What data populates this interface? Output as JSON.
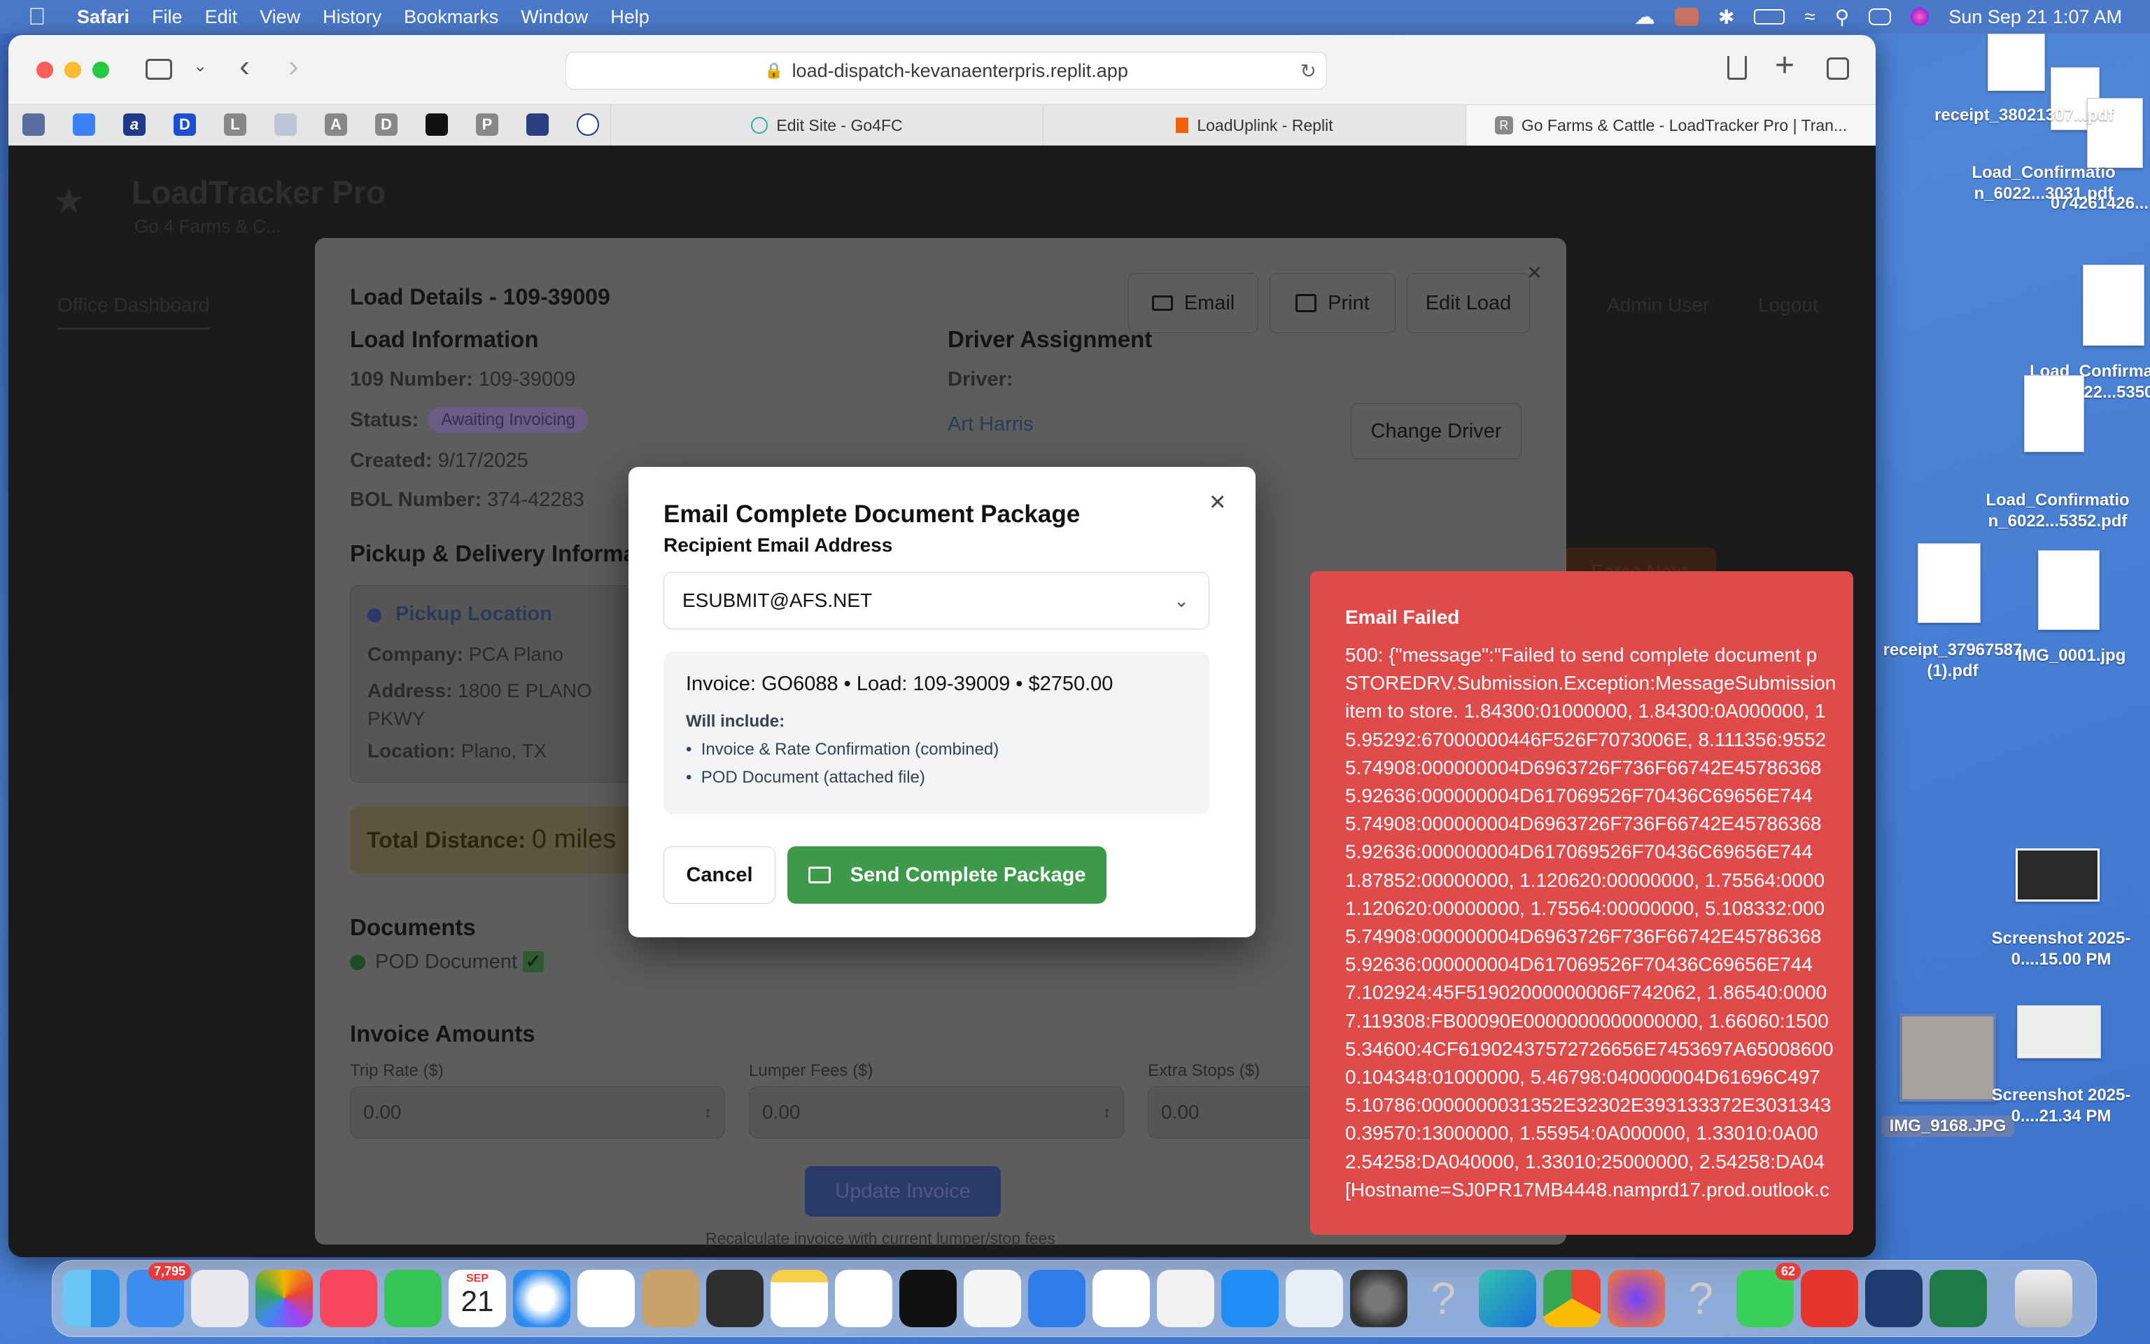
{
  "menubar": {
    "apple": "",
    "app": "Safari",
    "items": [
      "File",
      "Edit",
      "View",
      "History",
      "Bookmarks",
      "Window",
      "Help"
    ],
    "clock": "Sun Sep 21  1:07 AM"
  },
  "browser": {
    "url": "load-dispatch-kevanaenterpris.replit.app",
    "favorites": [
      "",
      "",
      "a",
      "D",
      "L",
      "",
      "A",
      "D",
      "",
      "P",
      "",
      ""
    ],
    "tabs": [
      {
        "label": "Edit Site - Go4FC",
        "active": false
      },
      {
        "label": "LoadUplink - Replit",
        "active": false
      },
      {
        "label": "Go Farms & Cattle - LoadTracker Pro | Tran...",
        "active": true
      }
    ]
  },
  "background_app": {
    "title": "LoadTracker Pro",
    "subtitle": "Go 4 Farms & C...",
    "tab_office": "Office Dashboard",
    "admin_user": "Admin User",
    "logout": "Logout",
    "force_next": "Force Next",
    "bottom_note": "..."
  },
  "load_modal": {
    "title": "Load Details - 109-39009",
    "email_btn": "Email",
    "print_btn": "Print",
    "edit_btn": "Edit Load",
    "load_info_heading": "Load Information",
    "number_label": "109 Number:",
    "number_value": "109-39009",
    "status_label": "Status:",
    "status_value": "Awaiting Invoicing",
    "created_label": "Created:",
    "created_value": "9/17/2025",
    "bol_label": "BOL Number:",
    "bol_value": "374-42283",
    "driver_heading": "Driver Assignment",
    "driver_label": "Driver:",
    "driver_name": "Art Harris",
    "change_driver": "Change Driver",
    "pickup_heading": "Pickup & Delivery Informa",
    "pickup_location": "Pickup Location",
    "company_label": "Company:",
    "company_value": "PCA Plano",
    "address_label": "Address:",
    "address_value_1": "1800 E PLANO",
    "address_value_2": "PKWY",
    "location_label": "Location:",
    "location_value": "Plano, TX",
    "distance_label": "Total Distance:",
    "distance_value": "0 miles",
    "documents_heading": "Documents",
    "pod_doc": "POD Document",
    "invoice_heading": "Invoice Amounts",
    "trip_rate_label": "Trip Rate ($)",
    "trip_rate_value": "0.00",
    "lumper_label": "Lumper Fees ($)",
    "lumper_value": "0.00",
    "extra_label": "Extra Stops ($)",
    "extra_value": "0.00",
    "update_btn": "Update Invoice",
    "recalc_note": "Recalculate invoice with current lumper/stop fees"
  },
  "email_modal": {
    "title": "Email Complete Document Package",
    "recipient_label": "Recipient Email Address",
    "recipient_value": "ESUBMIT@AFS.NET",
    "summary": "Invoice: GO6088 • Load: 109-39009 • $2750.00",
    "will_include": "Will include:",
    "include_1": "Invoice & Rate Confirmation (combined)",
    "include_2": "POD Document (attached file)",
    "cancel": "Cancel",
    "send": "Send Complete Package"
  },
  "toast": {
    "title": "Email Failed",
    "lines": [
      "500: {\"message\":\"Failed to send complete document p",
      "STOREDRV.Submission.Exception:MessageSubmission",
      "item to store. 1.84300:01000000, 1.84300:0A000000, 1",
      "5.95292:67000000446F526F7073006E, 8.111356:9552",
      "5.74908:000000004D6963726F736F66742E45786368",
      "5.92636:000000004D617069526F70436C69656E744",
      "5.74908:000000004D6963726F736F66742E45786368",
      "5.92636:000000004D617069526F70436C69656E744",
      "1.87852:00000000, 1.120620:00000000, 1.75564:0000",
      "1.120620:00000000, 1.75564:00000000, 5.108332:000",
      "5.74908:000000004D6963726F736F66742E45786368",
      "5.92636:000000004D617069526F70436C69656E744",
      "7.102924:45F51902000000006F742062, 1.86540:0000",
      "7.119308:FB00090E0000000000000000, 1.66060:1500",
      "5.34600:4CF61902437572726656E7453697A65008600",
      "0.104348:01000000, 5.46798:040000004D61696C497",
      "5.10786:0000000031352E32302E393133372E3031343",
      "0.39570:13000000, 1.55954:0A000000, 1.33010:0A00",
      "2.54258:DA040000, 1.33010:25000000, 2.54258:DA04",
      "[Hostname=SJ0PR17MB4448.namprd17.prod.outlook.c"
    ]
  },
  "desktop": {
    "icons": [
      "receipt_38021307...pdf",
      "Load_Confirmatio n_6022...3031.pdf",
      "074261426...",
      "Load_Confirmatio n_6022...5350",
      "Load_Confirmatio n_6022...5352.pdf",
      "receipt_37967587 (1).pdf",
      "IMG_0001.jpg",
      "Screenshot 2025-0....15.00 PM",
      "IMG_9168.JPG",
      "Screenshot 2025-0....21.34 PM"
    ]
  },
  "dock": {
    "mail_badge": "7,795",
    "calendar_month": "SEP",
    "calendar_day": "21",
    "messages_badge": "62"
  }
}
